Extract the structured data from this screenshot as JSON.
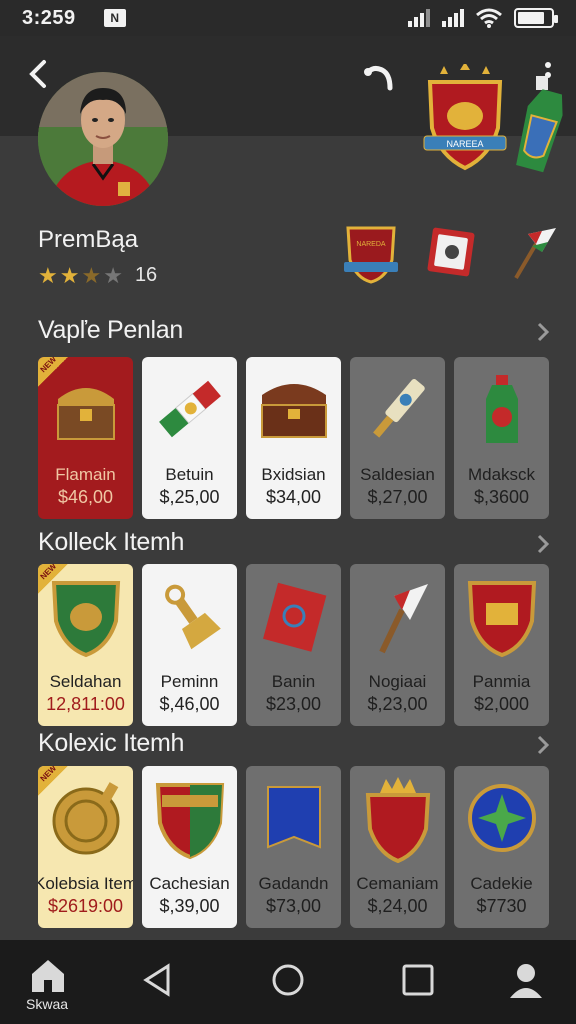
{
  "status_bar": {
    "time": "3:259",
    "notif_glyph": "N"
  },
  "profile": {
    "name": "PremBąa",
    "rating_stars_filled": 2,
    "rating_stars_total": 5,
    "rating_count": "16"
  },
  "sections": [
    {
      "title": "Vapľe Penlan",
      "items": [
        {
          "name": "Flamain",
          "price": "$46,00",
          "style": "red",
          "icon": "chest-icon",
          "ribbon": "NEW"
        },
        {
          "name": "Betuin",
          "price": "$,25,00",
          "style": "white",
          "icon": "scarf-icon"
        },
        {
          "name": "Bxidsian",
          "price": "$34,00",
          "style": "white",
          "icon": "treasure-chest-icon"
        },
        {
          "name": "Saldesian",
          "price": "$,27,00",
          "style": "gray",
          "icon": "torch-icon"
        },
        {
          "name": "Mdaksck",
          "price": "$,3600",
          "style": "gray",
          "icon": "bottle-icon"
        }
      ]
    },
    {
      "title": "Kolleck Itemh",
      "items": [
        {
          "name": "Seldahan",
          "price": "12,811:00",
          "style": "cream",
          "icon": "shield-icon",
          "ribbon": "NEW"
        },
        {
          "name": "Peminn",
          "price": "$,46,00",
          "style": "white",
          "icon": "bell-icon"
        },
        {
          "name": "Banin",
          "price": "$23,00",
          "style": "gray",
          "icon": "flag-icon"
        },
        {
          "name": "Nogiaai",
          "price": "$,23,00",
          "style": "gray",
          "icon": "pennant-icon"
        },
        {
          "name": "Panmia",
          "price": "$2,000",
          "style": "gray",
          "icon": "crest-icon"
        }
      ]
    },
    {
      "title": "Kolexic Itemh",
      "items": [
        {
          "name": "Kolebsia Item",
          "price": "$2619:00",
          "style": "cream",
          "icon": "medallion-icon",
          "ribbon": "NEW"
        },
        {
          "name": "Cachesian",
          "price": "$,39,00",
          "style": "white",
          "icon": "club-crest-icon"
        },
        {
          "name": "Gadandn",
          "price": "$73,00",
          "style": "gray",
          "icon": "banner-icon"
        },
        {
          "name": "Cemaniam",
          "price": "$,24,00",
          "style": "gray",
          "icon": "crown-shield-icon"
        },
        {
          "name": "Cadekie",
          "price": "$7730",
          "style": "gray",
          "icon": "emblem-icon"
        }
      ]
    }
  ],
  "header_badges": {
    "crest_text": "NAREEA",
    "mini_crest_text": "NAREDA"
  },
  "bottom_nav": {
    "home_label": "Skwaa"
  },
  "colors": {
    "accent_red": "#a31b1e",
    "gold": "#e2b23a",
    "background": "#3b3b3b"
  }
}
